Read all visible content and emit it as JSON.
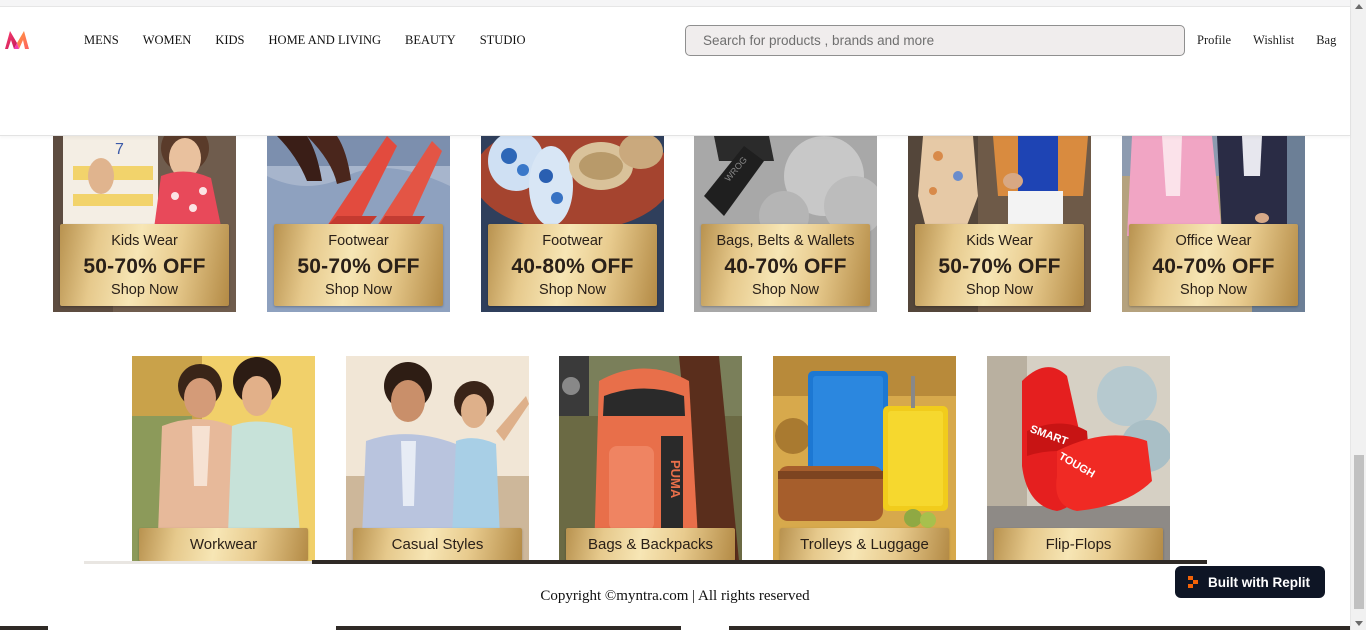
{
  "header": {
    "logo_icon": "myntra-logo-icon",
    "nav": [
      "MENS",
      "WOMEN",
      "KIDS",
      "HOME AND LIVING",
      "BEAUTY",
      "STUDIO"
    ],
    "search_placeholder": "Search for products , brands and more",
    "actions": [
      "Profile",
      "Wishlist",
      "Bag"
    ]
  },
  "deals": [
    {
      "title": "Kids Wear",
      "discount": "50-70% OFF",
      "cta": "Shop Now"
    },
    {
      "title": "Footwear",
      "discount": "50-70% OFF",
      "cta": "Shop Now"
    },
    {
      "title": "Footwear",
      "discount": "40-80% OFF",
      "cta": "Shop Now"
    },
    {
      "title": "Bags, Belts & Wallets",
      "discount": "40-70% OFF",
      "cta": "Shop Now"
    },
    {
      "title": "Kids Wear",
      "discount": "50-70% OFF",
      "cta": "Shop Now"
    },
    {
      "title": "Office Wear",
      "discount": "40-70% OFF",
      "cta": "Shop Now"
    }
  ],
  "categories": [
    {
      "label": "Workwear"
    },
    {
      "label": "Casual Styles"
    },
    {
      "label": "Bags & Backpacks"
    },
    {
      "label": "Trolleys & Luggage"
    },
    {
      "label": "Flip-Flops"
    }
  ],
  "footer": {
    "copyright": "Copyright ©myntra.com | All rights reserved"
  },
  "badge": {
    "label": "Built with Replit",
    "icon": "replit-icon"
  },
  "colors": {
    "brand_pink": "#ff3f6c",
    "brand_orange": "#ff9a3c",
    "gold": "#e6c98c",
    "badge_bg": "#0e1525"
  }
}
